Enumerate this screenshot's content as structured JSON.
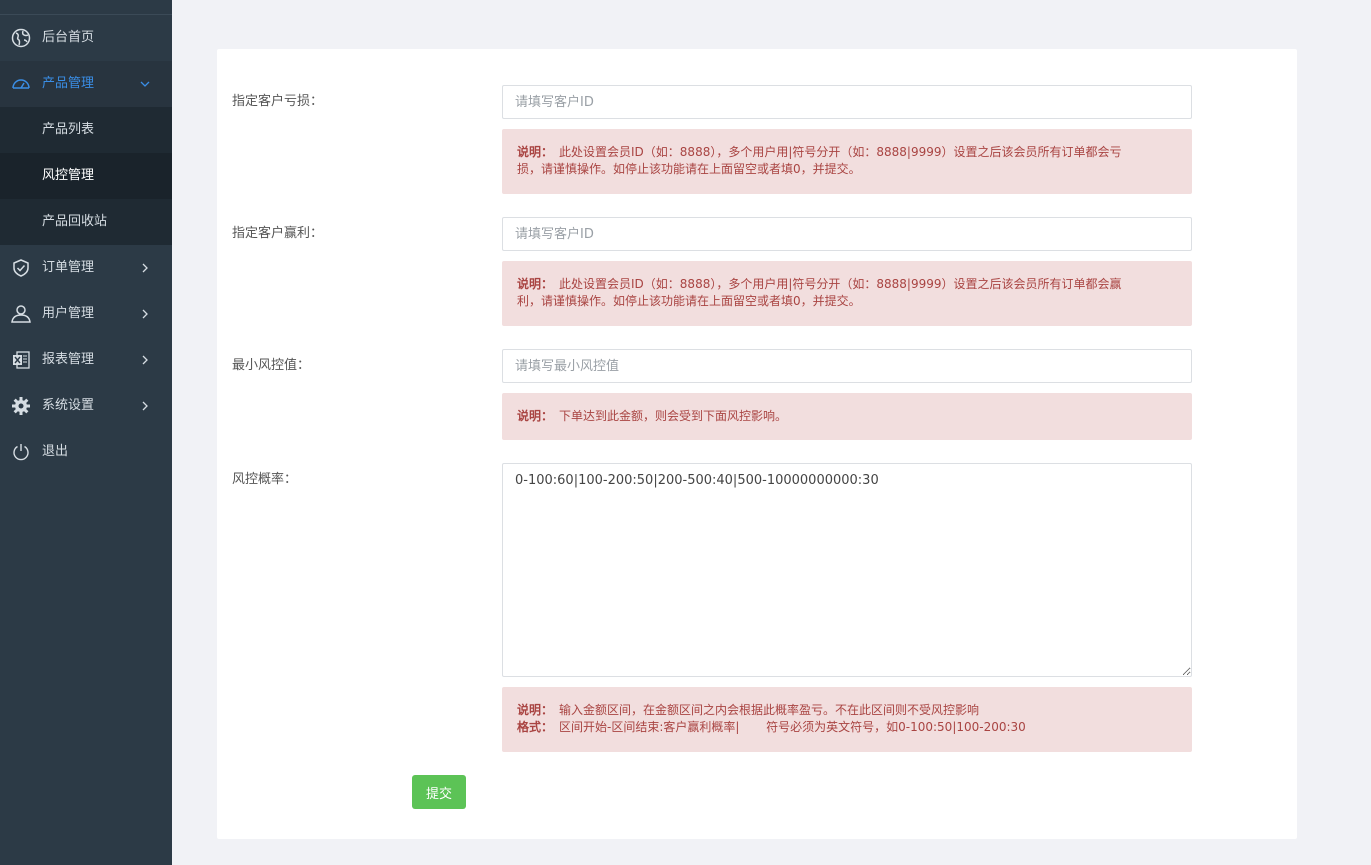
{
  "sidebar": {
    "items": [
      {
        "label": "后台首页",
        "icon": "globe-icon"
      },
      {
        "label": "产品管理",
        "icon": "dashboard-icon",
        "expanded": true
      },
      {
        "label": "订单管理",
        "icon": "shield-icon"
      },
      {
        "label": "用户管理",
        "icon": "user-icon"
      },
      {
        "label": "报表管理",
        "icon": "excel-icon"
      },
      {
        "label": "系统设置",
        "icon": "gear-icon"
      },
      {
        "label": "退出",
        "icon": "power-icon"
      }
    ],
    "sub_items": [
      {
        "label": "产品列表"
      },
      {
        "label": "风控管理",
        "current": true
      },
      {
        "label": "产品回收站"
      }
    ],
    "active_color": "#3a8ee6"
  },
  "form": {
    "loss": {
      "label": "指定客户亏损：",
      "placeholder": "请填写客户ID",
      "value": "",
      "note_prefix": "说明：",
      "note_line1": "此处设置会员ID（如：8888），多个用户用|符号分开（如：8888|9999）设置之后该会员所有订单都会亏",
      "note_line2": "损，请谨慎操作。如停止该功能请在上面留空或者填0，并提交。"
    },
    "win": {
      "label": "指定客户赢利：",
      "placeholder": "请填写客户ID",
      "value": "",
      "note_prefix": "说明：",
      "note_line1": "此处设置会员ID（如：8888），多个用户用|符号分开（如：8888|9999）设置之后该会员所有订单都会赢",
      "note_line2": "利，请谨慎操作。如停止该功能请在上面留空或者填0，并提交。"
    },
    "min_risk": {
      "label": "最小风控值：",
      "placeholder": "请填写最小风控值",
      "value": "",
      "note_prefix": "说明：",
      "note_line1": "下单达到此金额，则会受到下面风控影响。"
    },
    "risk_rate": {
      "label": "风控概率：",
      "value": "0-100:60|100-200:50|200-500:40|500-10000000000:30",
      "note_prefix": "说明：",
      "note_line1": "输入金额区间，在金额区间之内会根据此概率盈亏。不在此区间则不受风控影响",
      "format_prefix": "格式：",
      "format_line": "区间开始-区间结束:客户赢利概率|       符号必须为英文符号，如0-100:50|100-200:30"
    },
    "submit_label": "提交",
    "submit_color": "#5cc356",
    "note_bg": "#f2dede",
    "note_color": "#a94442"
  }
}
